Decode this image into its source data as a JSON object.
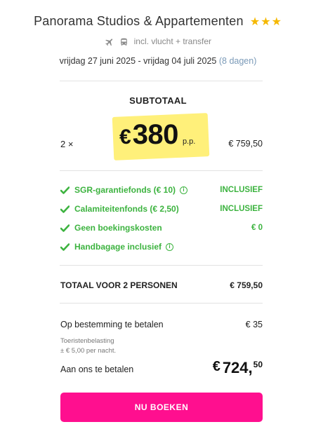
{
  "hotel": {
    "name": "Panorama Studios & Appartementen",
    "stars": "★★★"
  },
  "transport": {
    "label": "incl. vlucht + transfer",
    "icons": [
      "plane-icon",
      "bus-icon"
    ]
  },
  "dates": {
    "range": "vrijdag 27 juni 2025 - vrijdag 04 juli 2025",
    "nights": "(8 dagen)"
  },
  "summary": {
    "heading": "SUBTOTAAL",
    "quantity": "2 ×",
    "currency": "€",
    "price_per_person": "380",
    "pp_label": "p.p.",
    "subtotal": "€ 759,50"
  },
  "features": [
    {
      "label": "SGR-garantiefonds (€ 10)",
      "value": "INCLUSIEF",
      "info": true
    },
    {
      "label": "Calamiteitenfonds (€ 2,50)",
      "value": "INCLUSIEF",
      "info": false
    },
    {
      "label": "Geen boekingskosten",
      "value": "€ 0",
      "info": false
    },
    {
      "label": "Handbagage inclusief",
      "value": "",
      "info": true
    }
  ],
  "total": {
    "label": "TOTAAL VOOR 2 PERSONEN",
    "value": "€ 759,50"
  },
  "destination": {
    "label": "Op bestemming te betalen",
    "value": "€ 35",
    "tax_line1": "Toeristenbelasting",
    "tax_line2": "± € 5,00 per nacht."
  },
  "payment": {
    "label": "Aan ons te betalen",
    "currency": "€",
    "whole": "724,",
    "cents": "50"
  },
  "cta": {
    "label": "NU BOEKEN",
    "color": "#ff0f8f"
  },
  "colors": {
    "accent_green": "#3cb33f",
    "highlight_yellow": "#fff07a",
    "star": "#f5b800"
  }
}
